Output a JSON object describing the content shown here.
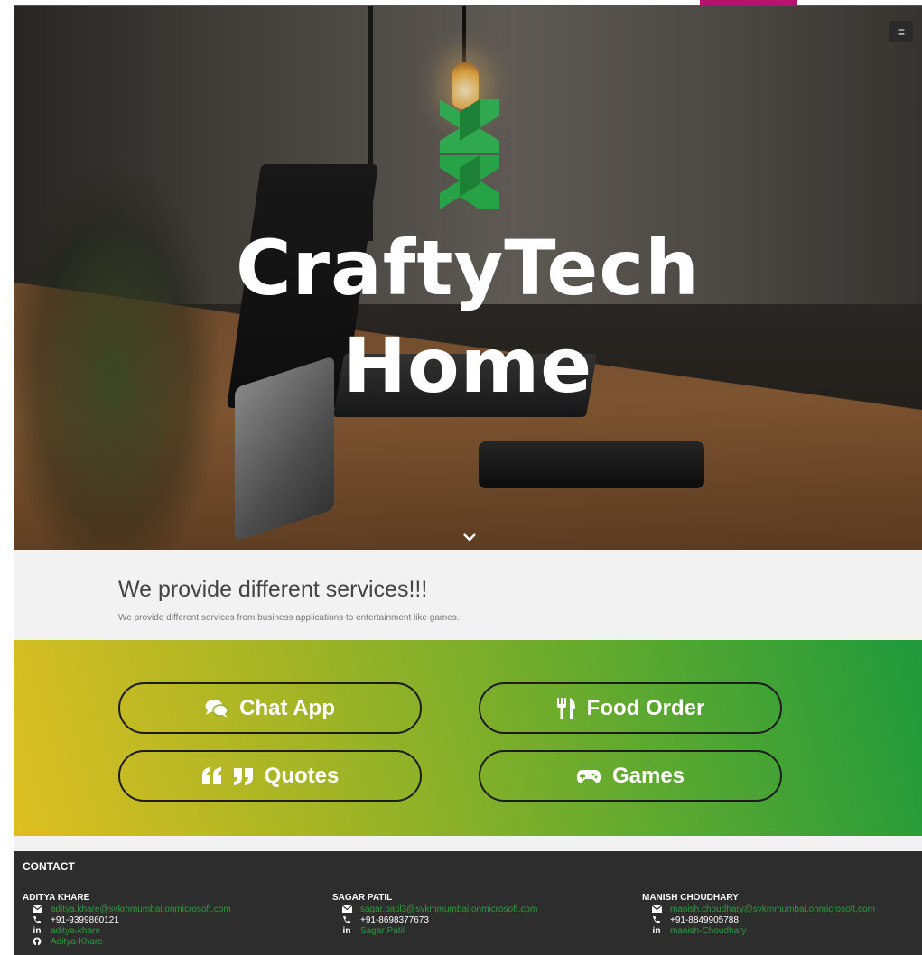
{
  "hero": {
    "title_line1": "CraftyTech",
    "title_line2": "Home",
    "menu_icon": "≡"
  },
  "services": {
    "title": "We provide different services!!!",
    "subtitle": "We provide different services from business applications to entertainment like games."
  },
  "buttons": [
    {
      "label": "Chat App",
      "icon": "comments-icon"
    },
    {
      "label": "Food Order",
      "icon": "utensils-icon"
    },
    {
      "label": "Quotes",
      "icon": "quote-icon"
    },
    {
      "label": "Games",
      "icon": "gamepad-icon"
    }
  ],
  "footer": {
    "heading": "CONTACT",
    "contacts": [
      {
        "name": "ADITYA KHARE",
        "email": "aditya.khare@svkmmumbai.onmicrosoft.com",
        "phone": "+91-9399860121",
        "linkedin": "aditya-khare",
        "github": "Aditya-Khare"
      },
      {
        "name": "SAGAR PATIL",
        "email": "sagar.patil3@svkmmumbai.onmicrosoft.com",
        "phone": "+91-8698377673",
        "linkedin": "Sagar Patil"
      },
      {
        "name": "MANISH CHOUDHARY",
        "email": "manish.choudhary@svkmmumbai.onmicrosoft.com",
        "phone": "+91-8849905788",
        "linkedin": "manish-Choudhary"
      }
    ]
  },
  "colors": {
    "accent_green": "#2e9b3c",
    "logo_green": "#2fa84f",
    "footer_bg": "#2d2d2d",
    "top_tab": "#b3146e"
  }
}
